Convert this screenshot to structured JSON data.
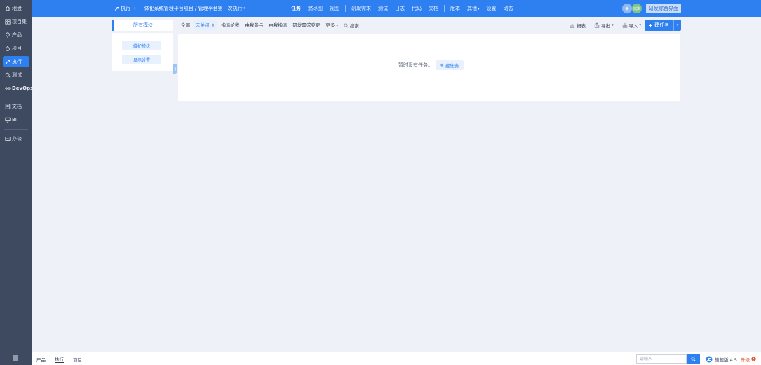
{
  "sidebar": {
    "items": [
      {
        "label": "地盘",
        "icon": "home-icon"
      },
      {
        "label": "项目集",
        "icon": "grid-icon"
      },
      {
        "label": "产品",
        "icon": "bulb-icon"
      },
      {
        "label": "项目",
        "icon": "drop-icon"
      },
      {
        "label": "执行",
        "icon": "rocket-icon",
        "active": true
      },
      {
        "label": "测试",
        "icon": "bug-search-icon"
      },
      {
        "label": "DevOps",
        "icon": "infinity-icon"
      },
      {
        "label": "文档",
        "icon": "doc-icon"
      },
      {
        "label": "BI",
        "icon": "monitor-icon"
      },
      {
        "label": "办公",
        "icon": "office-icon"
      }
    ]
  },
  "header": {
    "crumb_root": "执行",
    "crumb_path": "一体化系统管理平台项目 / 管理平台第一次执行",
    "nav": [
      "任务",
      "燃尽图",
      "视图",
      "研发需求",
      "测试",
      "日志",
      "代码",
      "文档",
      "版本",
      "其他",
      "设置",
      "动态"
    ],
    "avatar_text": "岚岚",
    "main_ui_label": "研发综合界面"
  },
  "module": {
    "title": "所有模块",
    "maintain": "维护模块",
    "display": "显示设置"
  },
  "filters": {
    "tabs": [
      "全部",
      "未关闭",
      "指派给我",
      "由我参与",
      "由我指派",
      "研发需求变更",
      "更多"
    ],
    "unclosed_count": "0",
    "search": "搜索"
  },
  "tools": {
    "report": "报表",
    "export": "导出",
    "import": "导入",
    "create": "建任务"
  },
  "content": {
    "empty_text": "暂时没有任务。",
    "empty_create": "建任务"
  },
  "footer": {
    "crumbs": [
      "产品",
      "执行",
      "项目"
    ],
    "search_placeholder": "请输入",
    "version": "旗舰版 4.5",
    "upgrade": "升级"
  },
  "colors": {
    "accent": "#2e7ff0",
    "sidebar": "#3d4a5f",
    "avatar1": "#8fb8f2",
    "avatar2": "#7cc58a"
  }
}
